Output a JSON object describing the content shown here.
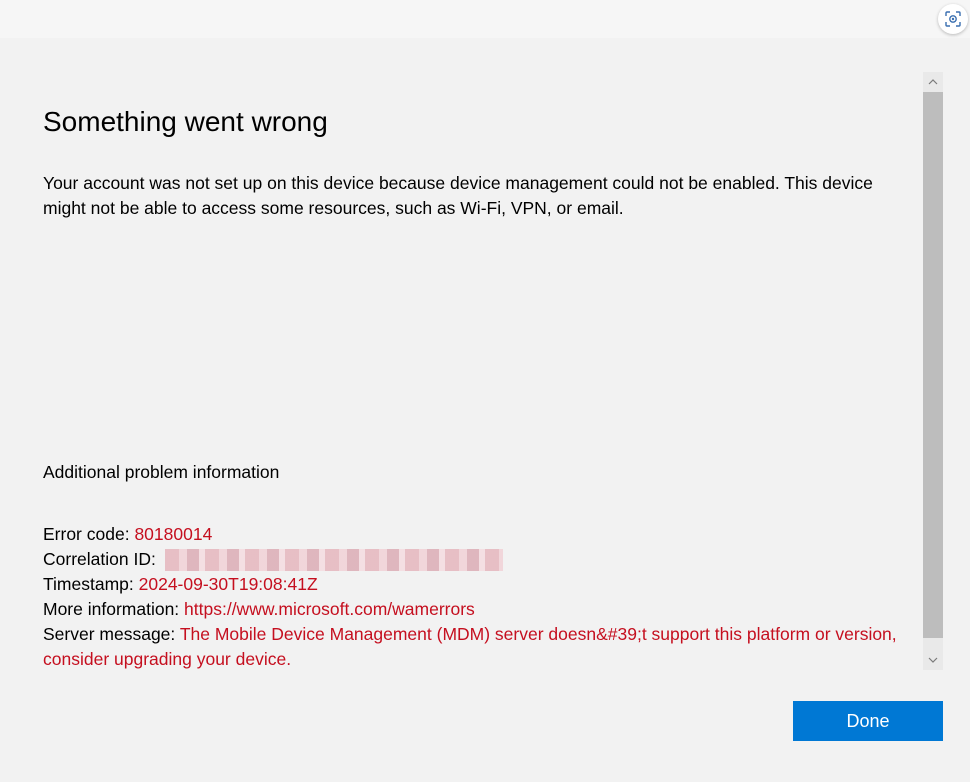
{
  "dialog": {
    "title": "Something went wrong",
    "description": "Your account was not set up on this device because device management could not be enabled. This device might not be able to access some resources, such as Wi-Fi, VPN, or email.",
    "additional_heading": "Additional problem information",
    "error_code_label": "Error code: ",
    "error_code_value": "80180014",
    "correlation_label": "Correlation ID: ",
    "timestamp_label": "Timestamp: ",
    "timestamp_value": "2024-09-30T19:08:41Z",
    "more_info_label": "More information: ",
    "more_info_link": "https://www.microsoft.com/wamerrors",
    "server_message_label": "Server message: ",
    "server_message_value": "The Mobile Device Management (MDM) server doesn&#39;t support this platform or version, consider upgrading your device.",
    "done_label": "Done"
  },
  "icons": {
    "corner": "camera-focus-icon",
    "scroll_up": "chevron-up-icon",
    "scroll_down": "chevron-down-icon"
  },
  "colors": {
    "accent": "#0078d4",
    "error_text": "#c50f1f",
    "background": "#f2f2f2"
  }
}
